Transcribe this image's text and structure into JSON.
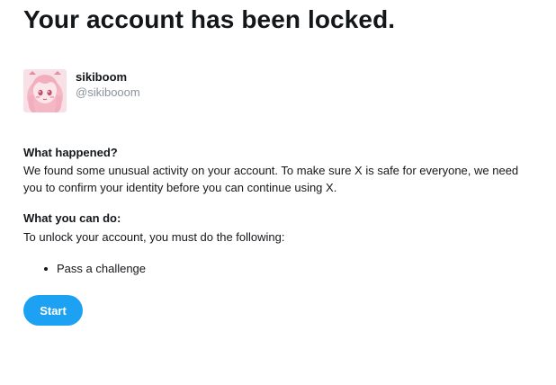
{
  "header": {
    "title": "Your account has been locked."
  },
  "profile": {
    "display_name": "sikiboom",
    "handle": "@sikibooom",
    "avatar_icon": "anime-girl-avatar"
  },
  "what_happened": {
    "heading": "What happened?",
    "text": "We found some unusual activity on your account. To make sure X is safe for everyone, we need you to confirm your identity before you can continue using X."
  },
  "what_you_can_do": {
    "heading": "What you can do:",
    "text": "To unlock your account, you must do the following:",
    "steps": [
      "Pass a challenge"
    ]
  },
  "actions": {
    "start_label": "Start"
  },
  "colors": {
    "accent": "#1da1f2",
    "text": "#14171a",
    "muted": "#8a939c"
  }
}
